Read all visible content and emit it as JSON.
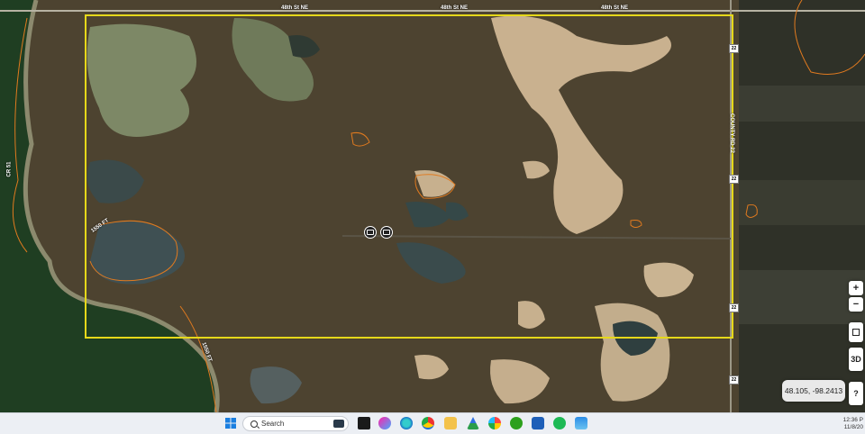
{
  "map": {
    "road_labels": {
      "top_left": "48th St NE",
      "top_middle": "48th St NE",
      "top_right": "48th St NE",
      "county_road": "COUNTY RD 22",
      "left_road": "CR 51"
    },
    "contour_labels": {
      "left": "1550 FT",
      "bottom": "1550 FT"
    },
    "route_shield": "22",
    "colors": {
      "parcel_outline": "#e6d81a",
      "contour": "#e07a1f",
      "water": "#1f3e22"
    }
  },
  "controls": {
    "zoom_in": "+",
    "zoom_out": "−",
    "threed": "3D",
    "help": "?"
  },
  "coordinates_readout": "48.105, -98.2413",
  "taskbar": {
    "search_placeholder": "Search",
    "time": "12:36 P",
    "date": "11/8/20"
  }
}
